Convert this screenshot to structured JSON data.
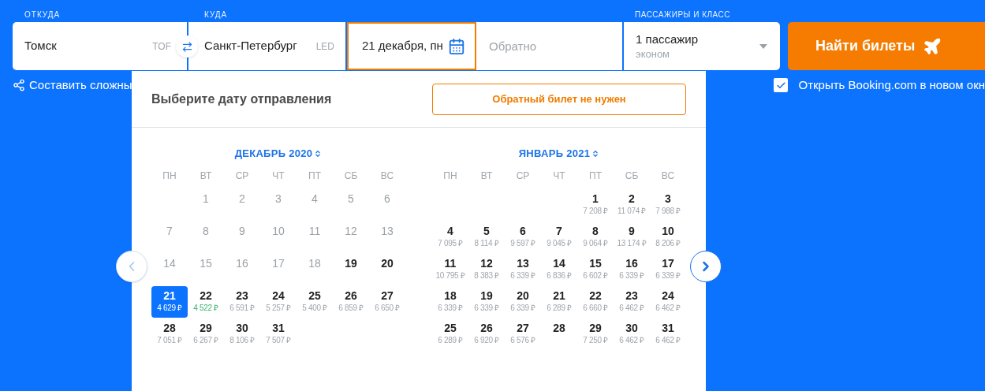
{
  "search_form": {
    "origin": {
      "label": "ОТКУДА",
      "value": "Томск",
      "code": "TOF"
    },
    "destination": {
      "label": "КУДА",
      "value": "Санкт-Петербург",
      "code": "LED"
    },
    "departure": {
      "value": "21 декабря, пн",
      "focused": true
    },
    "return": {
      "placeholder": "Обратно"
    },
    "passengers": {
      "label": "ПАССАЖИРЫ И КЛАСС",
      "value": "1 пассажир",
      "class": "эконом"
    },
    "search_button": "Найти билеты"
  },
  "complex_route_link": "Составить сложны",
  "booking_option": {
    "label": "Открыть Booking.com в новом окн",
    "checked": true
  },
  "date_picker": {
    "title": "Выберите дату отправления",
    "no_return_button": "Обратный билет не нужен",
    "months": [
      {
        "title": "ДЕКАБРЬ 2020",
        "weekdays": [
          "ПН",
          "ВТ",
          "СР",
          "ЧТ",
          "ПТ",
          "СБ",
          "ВС"
        ],
        "weeks": [
          {
            "kind": "first",
            "days": [
              {
                "day": "1",
                "disabled": true,
                "selected": false
              },
              {
                "day": "2",
                "disabled": true,
                "selected": false
              },
              {
                "day": "3",
                "disabled": true,
                "selected": false
              },
              {
                "day": "4",
                "disabled": true,
                "selected": false
              },
              {
                "day": "5",
                "disabled": true,
                "selected": false
              },
              {
                "day": "6",
                "disabled": true,
                "selected": false
              }
            ]
          },
          {
            "kind": "full",
            "days": [
              {
                "day": "7",
                "disabled": true,
                "selected": false
              },
              {
                "day": "8",
                "disabled": true,
                "selected": false
              },
              {
                "day": "9",
                "disabled": true,
                "selected": false
              },
              {
                "day": "10",
                "disabled": true,
                "selected": false
              },
              {
                "day": "11",
                "disabled": true,
                "selected": false
              },
              {
                "day": "12",
                "disabled": true,
                "selected": false
              },
              {
                "day": "13",
                "disabled": true,
                "selected": false
              }
            ]
          },
          {
            "kind": "full",
            "days": [
              {
                "day": "14",
                "disabled": true,
                "selected": false
              },
              {
                "day": "15",
                "disabled": true,
                "selected": false
              },
              {
                "day": "16",
                "disabled": true,
                "selected": false
              },
              {
                "day": "17",
                "disabled": true,
                "selected": false
              },
              {
                "day": "18",
                "disabled": true,
                "selected": false
              },
              {
                "day": "19",
                "disabled": false,
                "selected": false
              },
              {
                "day": "20",
                "disabled": false,
                "selected": false
              }
            ]
          },
          {
            "kind": "full",
            "days": [
              {
                "day": "21",
                "price": "4 629 ₽",
                "disabled": false,
                "selected": true,
                "cheapest": false
              },
              {
                "day": "22",
                "price": "4 522 ₽",
                "disabled": false,
                "selected": false,
                "cheapest": true
              },
              {
                "day": "23",
                "price": "6 591 ₽",
                "disabled": false,
                "selected": false,
                "cheapest": false
              },
              {
                "day": "24",
                "price": "5 257 ₽",
                "disabled": false,
                "selected": false,
                "cheapest": false
              },
              {
                "day": "25",
                "price": "5 400 ₽",
                "disabled": false,
                "selected": false,
                "cheapest": false
              },
              {
                "day": "26",
                "price": "6 859 ₽",
                "disabled": false,
                "selected": false,
                "cheapest": false
              },
              {
                "day": "27",
                "price": "6 650 ₽",
                "disabled": false,
                "selected": false,
                "cheapest": false
              }
            ]
          },
          {
            "kind": "last",
            "days": [
              {
                "day": "28",
                "price": "7 051 ₽",
                "disabled": false,
                "selected": false,
                "cheapest": false
              },
              {
                "day": "29",
                "price": "6 267 ₽",
                "disabled": false,
                "selected": false,
                "cheapest": false
              },
              {
                "day": "30",
                "price": "8 106 ₽",
                "disabled": false,
                "selected": false,
                "cheapest": false
              },
              {
                "day": "31",
                "price": "7 507 ₽",
                "disabled": false,
                "selected": false,
                "cheapest": false
              }
            ]
          }
        ]
      },
      {
        "title": "ЯНВАРЬ 2021",
        "weekdays": [
          "ПН",
          "ВТ",
          "СР",
          "ЧТ",
          "ПТ",
          "СБ",
          "ВС"
        ],
        "weeks": [
          {
            "kind": "first",
            "days": [
              {
                "day": "1",
                "price": "7 208 ₽",
                "disabled": false,
                "selected": false,
                "cheapest": false
              },
              {
                "day": "2",
                "price": "11 074 ₽",
                "disabled": false,
                "selected": false,
                "cheapest": false
              },
              {
                "day": "3",
                "price": "7 988 ₽",
                "disabled": false,
                "selected": false,
                "cheapest": false
              }
            ]
          },
          {
            "kind": "full",
            "days": [
              {
                "day": "4",
                "price": "7 095 ₽",
                "disabled": false,
                "selected": false,
                "cheapest": false
              },
              {
                "day": "5",
                "price": "8 114 ₽",
                "disabled": false,
                "selected": false,
                "cheapest": false
              },
              {
                "day": "6",
                "price": "9 597 ₽",
                "disabled": false,
                "selected": false,
                "cheapest": false
              },
              {
                "day": "7",
                "price": "9 045 ₽",
                "disabled": false,
                "selected": false,
                "cheapest": false
              },
              {
                "day": "8",
                "price": "9 064 ₽",
                "disabled": false,
                "selected": false,
                "cheapest": false
              },
              {
                "day": "9",
                "price": "13 174 ₽",
                "disabled": false,
                "selected": false,
                "cheapest": false
              },
              {
                "day": "10",
                "price": "8 206 ₽",
                "disabled": false,
                "selected": false,
                "cheapest": false
              }
            ]
          },
          {
            "kind": "full",
            "days": [
              {
                "day": "11",
                "price": "10 795 ₽",
                "disabled": false,
                "selected": false,
                "cheapest": false
              },
              {
                "day": "12",
                "price": "8 383 ₽",
                "disabled": false,
                "selected": false,
                "cheapest": false
              },
              {
                "day": "13",
                "price": "6 339 ₽",
                "disabled": false,
                "selected": false,
                "cheapest": false
              },
              {
                "day": "14",
                "price": "6 836 ₽",
                "disabled": false,
                "selected": false,
                "cheapest": false
              },
              {
                "day": "15",
                "price": "6 602 ₽",
                "disabled": false,
                "selected": false,
                "cheapest": false
              },
              {
                "day": "16",
                "price": "6 339 ₽",
                "disabled": false,
                "selected": false,
                "cheapest": false
              },
              {
                "day": "17",
                "price": "6 339 ₽",
                "disabled": false,
                "selected": false,
                "cheapest": false
              }
            ]
          },
          {
            "kind": "full",
            "days": [
              {
                "day": "18",
                "price": "6 339 ₽",
                "disabled": false,
                "selected": false,
                "cheapest": false
              },
              {
                "day": "19",
                "price": "6 339 ₽",
                "disabled": false,
                "selected": false,
                "cheapest": false
              },
              {
                "day": "20",
                "price": "6 339 ₽",
                "disabled": false,
                "selected": false,
                "cheapest": false
              },
              {
                "day": "21",
                "price": "6 289 ₽",
                "disabled": false,
                "selected": false,
                "cheapest": false
              },
              {
                "day": "22",
                "price": "6 660 ₽",
                "disabled": false,
                "selected": false,
                "cheapest": false
              },
              {
                "day": "23",
                "price": "6 462 ₽",
                "disabled": false,
                "selected": false,
                "cheapest": false
              },
              {
                "day": "24",
                "price": "6 462 ₽",
                "disabled": false,
                "selected": false,
                "cheapest": false
              }
            ]
          },
          {
            "kind": "last",
            "days": [
              {
                "day": "25",
                "price": "6 289 ₽",
                "disabled": false,
                "selected": false,
                "cheapest": false
              },
              {
                "day": "26",
                "price": "6 920 ₽",
                "disabled": false,
                "selected": false,
                "cheapest": false
              },
              {
                "day": "27",
                "price": "6 576 ₽",
                "disabled": false,
                "selected": false,
                "cheapest": false
              },
              {
                "day": "28",
                "disabled": false,
                "selected": false
              },
              {
                "day": "29",
                "price": "7 250 ₽",
                "disabled": false,
                "selected": false,
                "cheapest": false
              },
              {
                "day": "30",
                "price": "6 462 ₽",
                "disabled": false,
                "selected": false,
                "cheapest": false
              },
              {
                "day": "31",
                "price": "6 462 ₽",
                "disabled": false,
                "selected": false,
                "cheapest": false
              }
            ]
          }
        ]
      }
    ]
  }
}
